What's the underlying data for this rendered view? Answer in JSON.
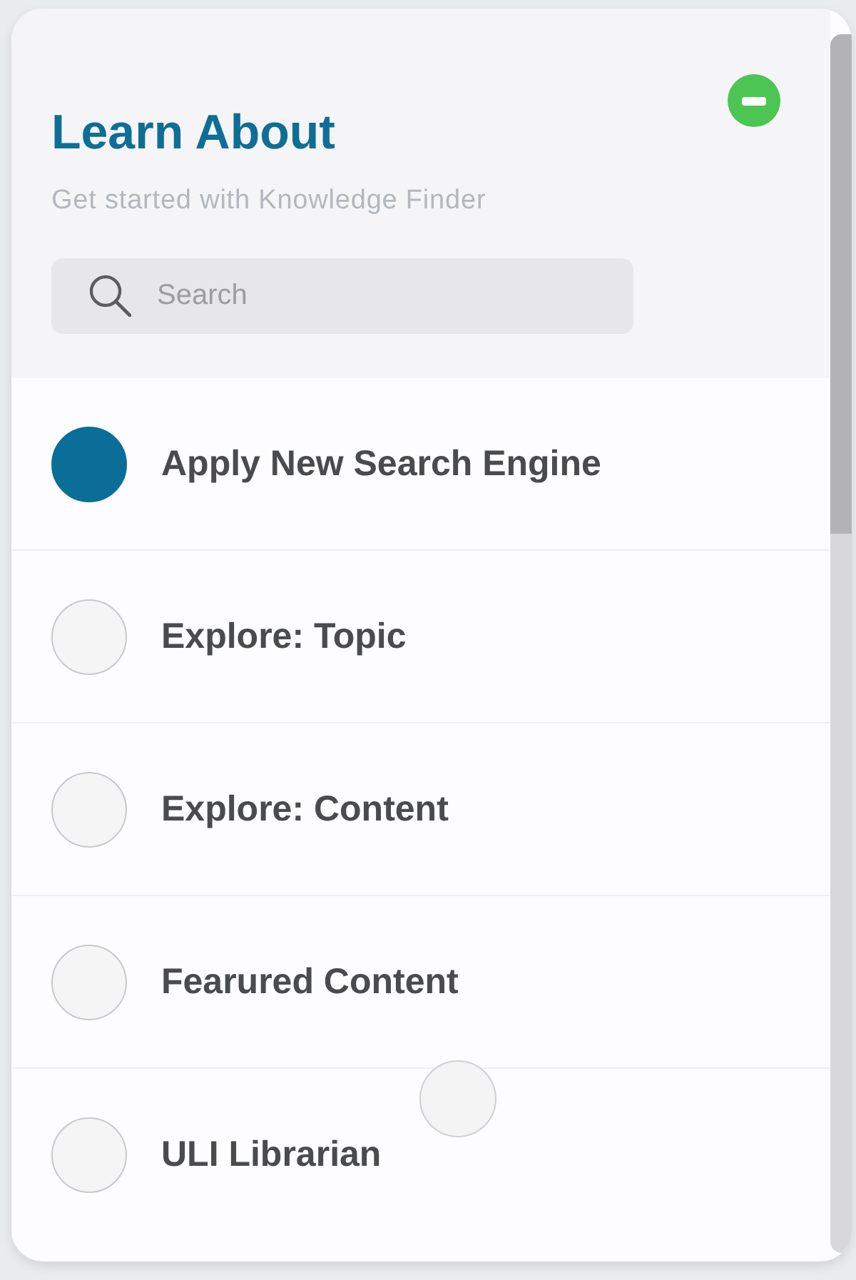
{
  "header": {
    "title": "Learn About",
    "subtitle": "Get started with Knowledge Finder",
    "search": {
      "placeholder": "Search"
    }
  },
  "items": [
    {
      "label": "Apply New Search Engine",
      "selected": true
    },
    {
      "label": "Explore: Topic",
      "selected": false
    },
    {
      "label": "Explore: Content",
      "selected": false
    },
    {
      "label": "Fearured Content",
      "selected": false
    },
    {
      "label": "ULI Librarian",
      "selected": false
    }
  ]
}
